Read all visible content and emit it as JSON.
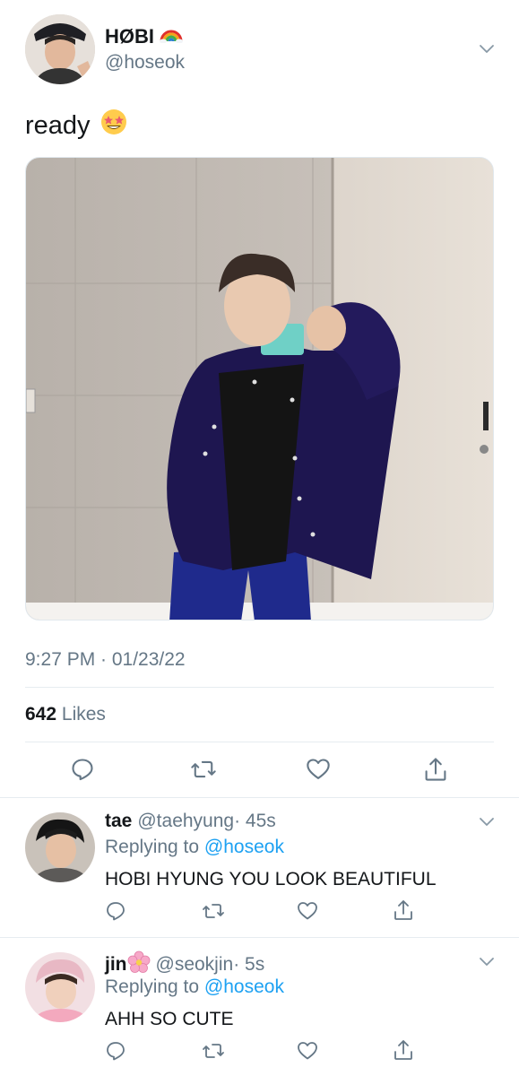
{
  "tweet": {
    "author_name": "HØBI",
    "author_badge_icon": "rainbow-emoji",
    "author_handle": "@hoseok",
    "text": "ready",
    "text_emoji_icon": "star-struck-emoji",
    "timestamp": "9:27 PM · 01/23/22",
    "likes_count": "642",
    "likes_label": "Likes"
  },
  "replies": [
    {
      "name": "tae",
      "handle": "@taehyung",
      "time": "· 45s",
      "replying_prefix": "Replying to",
      "replying_to": "@hoseok",
      "text": "HOBI HYUNG YOU LOOK BEAUTIFUL"
    },
    {
      "name": "jin",
      "name_emoji_icon": "cherry-blossom-emoji",
      "handle": "@seokjin",
      "time": "· 5s",
      "replying_prefix": "Replying to",
      "replying_to": "@hoseok",
      "text": "AHH SO CUTE"
    }
  ],
  "colors": {
    "accent": "#1da1f2",
    "secondary_text": "#657786",
    "primary_text": "#14171a",
    "divider": "#e6ecf0"
  }
}
